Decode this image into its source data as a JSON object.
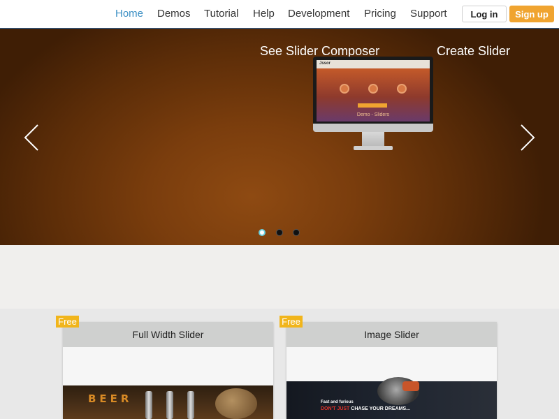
{
  "nav": {
    "items": [
      {
        "label": "Home",
        "active": true
      },
      {
        "label": "Demos",
        "active": false
      },
      {
        "label": "Tutorial",
        "active": false
      },
      {
        "label": "Help",
        "active": false
      },
      {
        "label": "Development",
        "active": false
      },
      {
        "label": "Pricing",
        "active": false
      },
      {
        "label": "Support",
        "active": false
      }
    ],
    "login_label": "Log in",
    "signup_label": "Sign up"
  },
  "colors": {
    "accent": "#3b8fc4",
    "signup": "#f0a430",
    "badge": "#f1b51b",
    "hero": "#7a3d0d"
  },
  "hero": {
    "left_title": "See Slider Composer",
    "right_title": "Create Slider",
    "prev_icon": "chevron-left-icon",
    "next_icon": "chevron-right-icon",
    "slide_count": 3,
    "active_slide": 0,
    "monitor": {
      "logo": "Jssor",
      "caption": "Demo - Sliders"
    }
  },
  "cards": [
    {
      "badge": "Free",
      "title": "Full Width Slider",
      "image_text": "BEER"
    },
    {
      "badge": "Free",
      "title": "Image Slider",
      "image_small": "Fast and furious",
      "image_red": "DON'T JUST",
      "image_rest": "CHASE YOUR DREAMS..."
    }
  ]
}
